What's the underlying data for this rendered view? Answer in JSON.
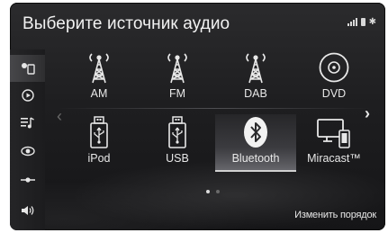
{
  "header": {
    "title": "Выберите источник аудио",
    "status_icons": [
      "signal-icon",
      "battery-icon",
      "bluetooth-icon"
    ]
  },
  "sidebar": {
    "items": [
      {
        "name": "audio-source-icon",
        "active": true
      },
      {
        "name": "play-icon",
        "active": false
      },
      {
        "name": "playlist-icon",
        "active": false
      },
      {
        "name": "eye-icon",
        "active": false
      },
      {
        "name": "equalizer-icon",
        "active": false
      },
      {
        "name": "volume-icon",
        "active": false
      }
    ]
  },
  "sources": [
    {
      "label": "AM",
      "icon": "antenna-icon"
    },
    {
      "label": "FM",
      "icon": "antenna-icon"
    },
    {
      "label": "DAB",
      "icon": "antenna-icon"
    },
    {
      "label": "DVD",
      "icon": "disc-icon"
    },
    {
      "label": "iPod",
      "icon": "usb-device-icon"
    },
    {
      "label": "USB",
      "icon": "usb-device-icon"
    },
    {
      "label": "Bluetooth",
      "icon": "bluetooth-icon",
      "selected": true
    },
    {
      "label": "Miracast™",
      "icon": "screen-phone-icon"
    }
  ],
  "pagination": {
    "pages": 2,
    "current": 1
  },
  "footer": {
    "reorder_label": "Изменить порядок"
  },
  "colors": {
    "text": "#e8e8e8",
    "background": "#1e1e20",
    "selected_highlight": "#a0a0a8"
  }
}
